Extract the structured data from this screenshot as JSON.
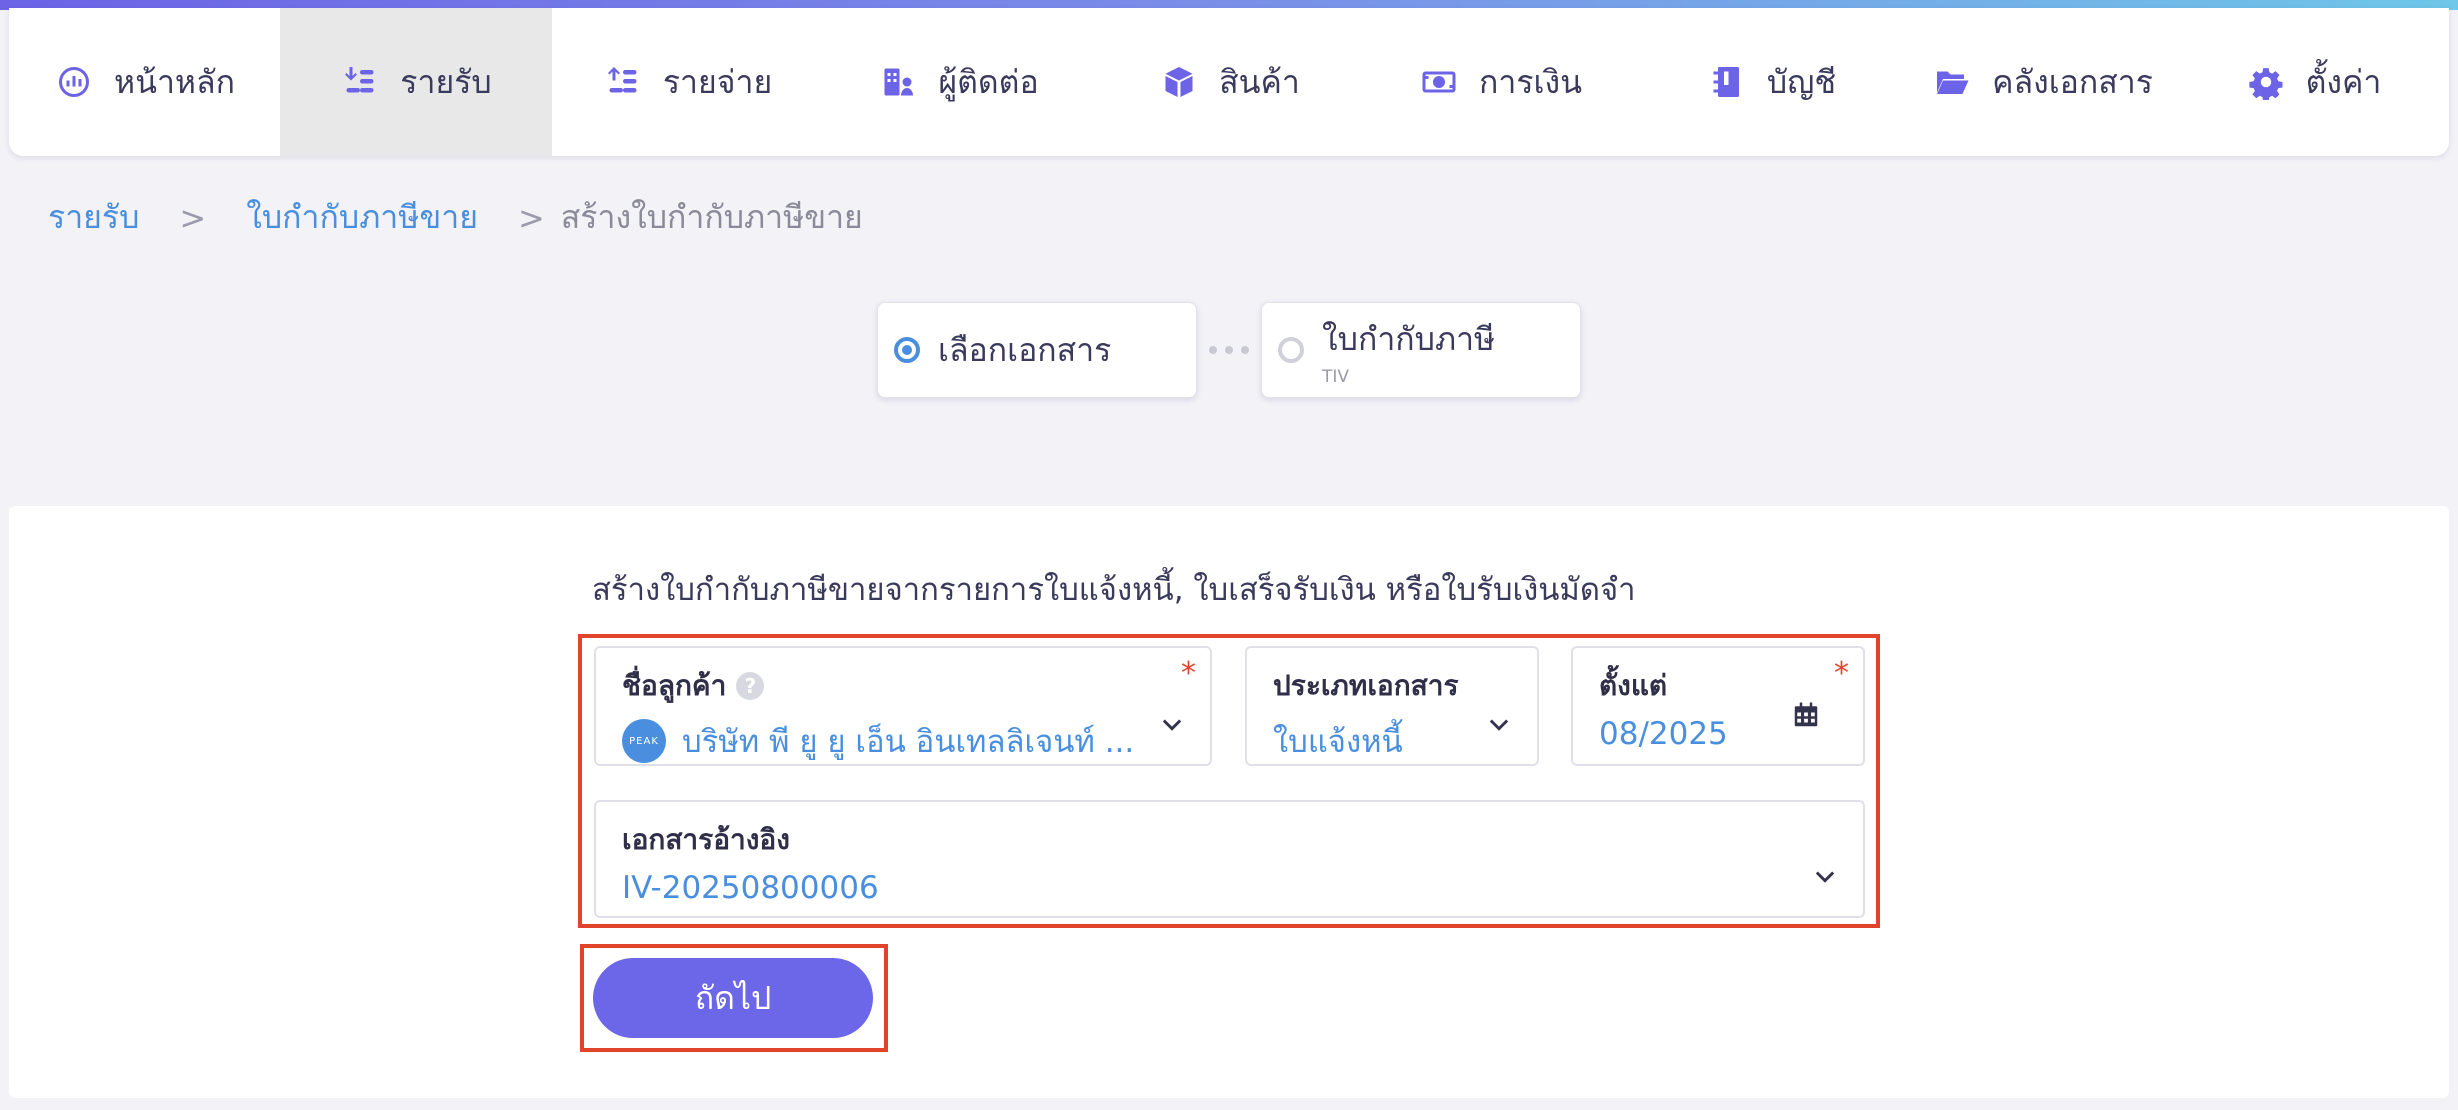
{
  "nav": {
    "items": [
      {
        "label": "หน้าหลัก",
        "icon": "dashboard-icon"
      },
      {
        "label": "รายรับ",
        "icon": "income-icon"
      },
      {
        "label": "รายจ่าย",
        "icon": "expense-icon"
      },
      {
        "label": "ผู้ติดต่อ",
        "icon": "contacts-icon"
      },
      {
        "label": "สินค้า",
        "icon": "product-box-icon"
      },
      {
        "label": "การเงิน",
        "icon": "money-icon"
      },
      {
        "label": "บัญชี",
        "icon": "ledger-icon"
      },
      {
        "label": "คลังเอกสาร",
        "icon": "folder-icon"
      },
      {
        "label": "ตั้งค่า",
        "icon": "gear-icon"
      }
    ],
    "active_index": 1
  },
  "breadcrumb": {
    "items": [
      "รายรับ",
      "ใบกำกับภาษีขาย",
      "สร้างใบกำกับภาษีขาย"
    ],
    "separator": ">"
  },
  "steps": [
    {
      "label": "เลือกเอกสาร",
      "sub": ""
    },
    {
      "label": "ใบกำกับภาษี",
      "sub": "TIV"
    }
  ],
  "form": {
    "description": "สร้างใบกำกับภาษีขายจากรายการใบแจ้งหนี้, ใบเสร็จรับเงิน หรือใบรับเงินมัดจำ",
    "customer": {
      "label": "ชื่อลูกค้า",
      "value": "บริษัท พี ยู ยู เอ็น อินเทลลิเจนท์ ...",
      "logo_text": "PEAK",
      "required_mark": "*"
    },
    "doc_type": {
      "label": "ประเภทเอกสาร",
      "value": "ใบแจ้งหนี้"
    },
    "since": {
      "label": "ตั้งแต่",
      "value": "08/2025",
      "required_mark": "*"
    },
    "reference": {
      "label": "เอกสารอ้างอิง",
      "value": "IV-20250800006"
    },
    "next_label": "ถัดไป"
  },
  "colors": {
    "accent": "#6c66e8",
    "link": "#4a8fdf",
    "highlight": "#e0452c"
  }
}
